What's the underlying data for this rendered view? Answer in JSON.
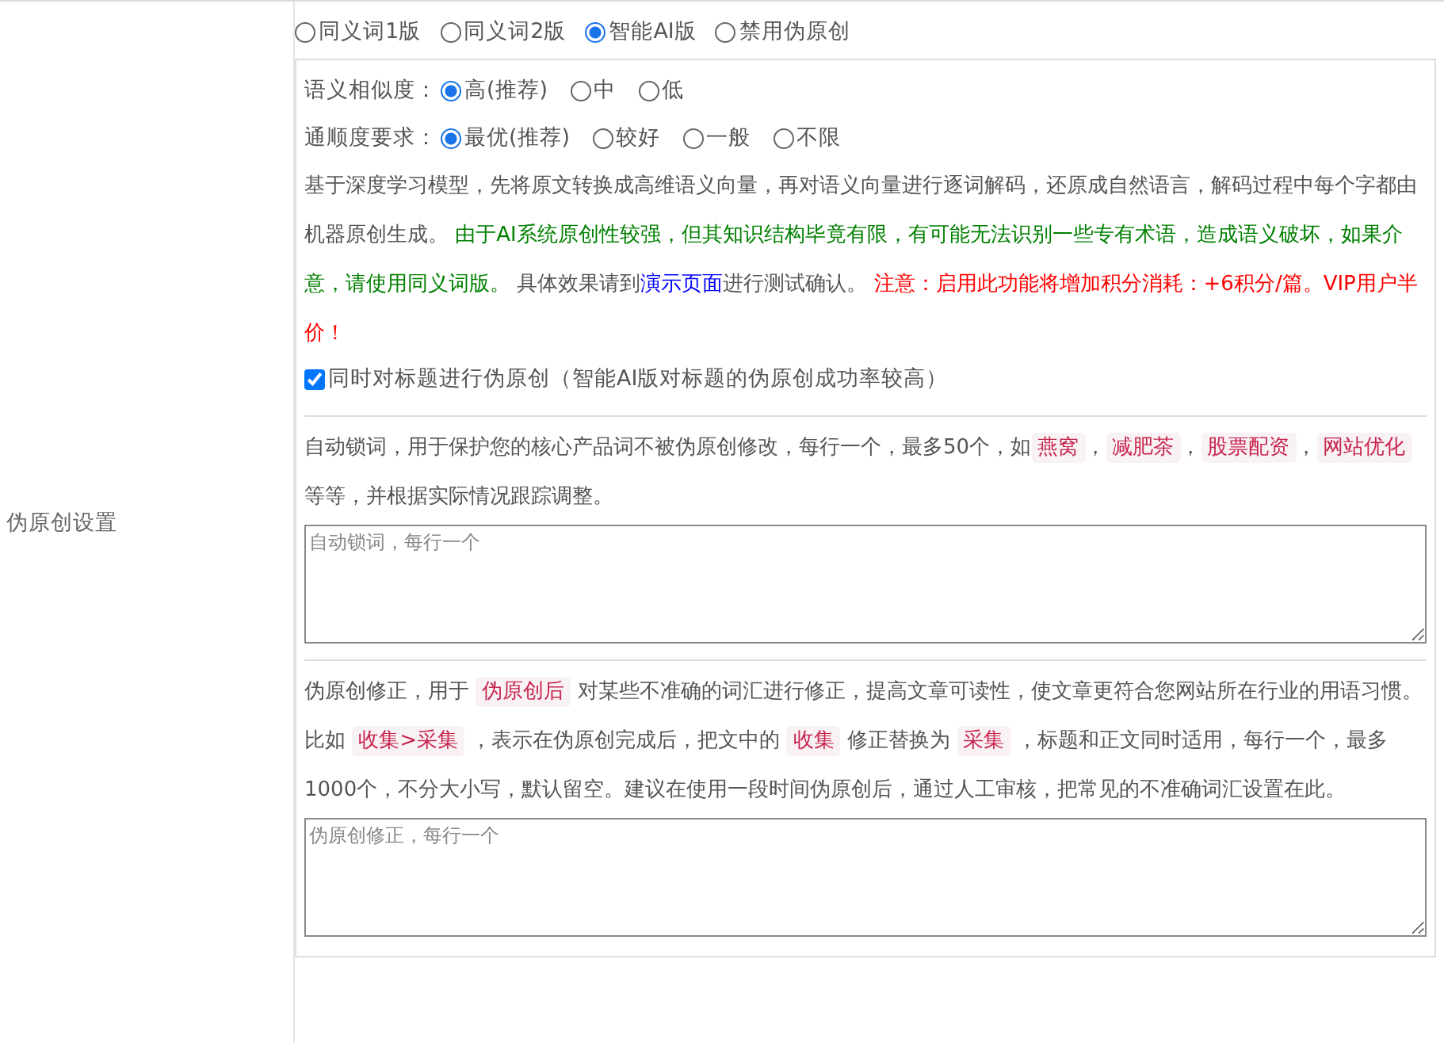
{
  "row_label": "伪原创设置",
  "mode_options": [
    {
      "label": "同义词1版",
      "selected": false
    },
    {
      "label": "同义词2版",
      "selected": false
    },
    {
      "label": "智能AI版",
      "selected": true
    },
    {
      "label": "禁用伪原创",
      "selected": false
    }
  ],
  "settings": [
    {
      "label": "语义相似度：",
      "options": [
        {
          "label": "高(推荐)",
          "selected": true
        },
        {
          "label": "中",
          "selected": false
        },
        {
          "label": "低",
          "selected": false
        }
      ]
    },
    {
      "label": "通顺度要求：",
      "options": [
        {
          "label": "最优(推荐)",
          "selected": true
        },
        {
          "label": "较好",
          "selected": false
        },
        {
          "label": "一般",
          "selected": false
        },
        {
          "label": "不限",
          "selected": false
        }
      ]
    }
  ],
  "ai_description": [
    {
      "kind": "plain",
      "text": "基于深度学习模型，先将原文转换成高维语义向量，再对语义向量进行逐词解码，还原成自然语言，解码过程中每个字都由机器原创生成。 "
    },
    {
      "kind": "green",
      "text": "由于AI系统原创性较强，但其知识结构毕竟有限，有可能无法识别一些专有术语，造成语义破坏，如果介意，请使用同义词版。"
    },
    {
      "kind": "plain",
      "text": " 具体效果请到"
    },
    {
      "kind": "link",
      "text": "演示页面"
    },
    {
      "kind": "plain",
      "text": "进行测试确认。 "
    },
    {
      "kind": "red",
      "text": "注意：启用此功能将增加积分消耗：+6积分/篇。VIP用户半价！"
    }
  ],
  "title_option": {
    "label": "同时对标题进行伪原创（智能AI版对标题的伪原创成功率较高）",
    "checked": true
  },
  "lock_words": {
    "description": [
      {
        "kind": "plain",
        "text": "自动锁词，用于保护您的核心产品词不被伪原创修改，每行一个，最多50个，如"
      },
      {
        "kind": "code",
        "text": "燕窝"
      },
      {
        "kind": "plain",
        "text": "，"
      },
      {
        "kind": "code",
        "text": "减肥茶"
      },
      {
        "kind": "plain",
        "text": "，"
      },
      {
        "kind": "code",
        "text": "股票配资"
      },
      {
        "kind": "plain",
        "text": "，"
      },
      {
        "kind": "code",
        "text": "网站优化"
      },
      {
        "kind": "plain",
        "text": " 等等，并根据实际情况跟踪调整。"
      }
    ],
    "placeholder": "自动锁词，每行一个"
  },
  "correction": {
    "description": [
      {
        "kind": "plain",
        "text": "伪原创修正，用于 "
      },
      {
        "kind": "code",
        "text": "伪原创后"
      },
      {
        "kind": "plain",
        "text": " 对某些不准确的词汇进行修正，提高文章可读性，使文章更符合您网站所在行业的用语习惯。比如 "
      },
      {
        "kind": "code",
        "text": "收集>采集"
      },
      {
        "kind": "plain",
        "text": " ，表示在伪原创完成后，把文中的 "
      },
      {
        "kind": "code",
        "text": "收集"
      },
      {
        "kind": "plain",
        "text": " 修正替换为 "
      },
      {
        "kind": "code",
        "text": "采集"
      },
      {
        "kind": "plain",
        "text": " ，标题和正文同时适用，每行一个，最多1000个，不分大小写，默认留空。建议在使用一段时间伪原创后，通过人工审核，把常见的不准确词汇设置在此。"
      }
    ],
    "placeholder": "伪原创修正，每行一个"
  }
}
